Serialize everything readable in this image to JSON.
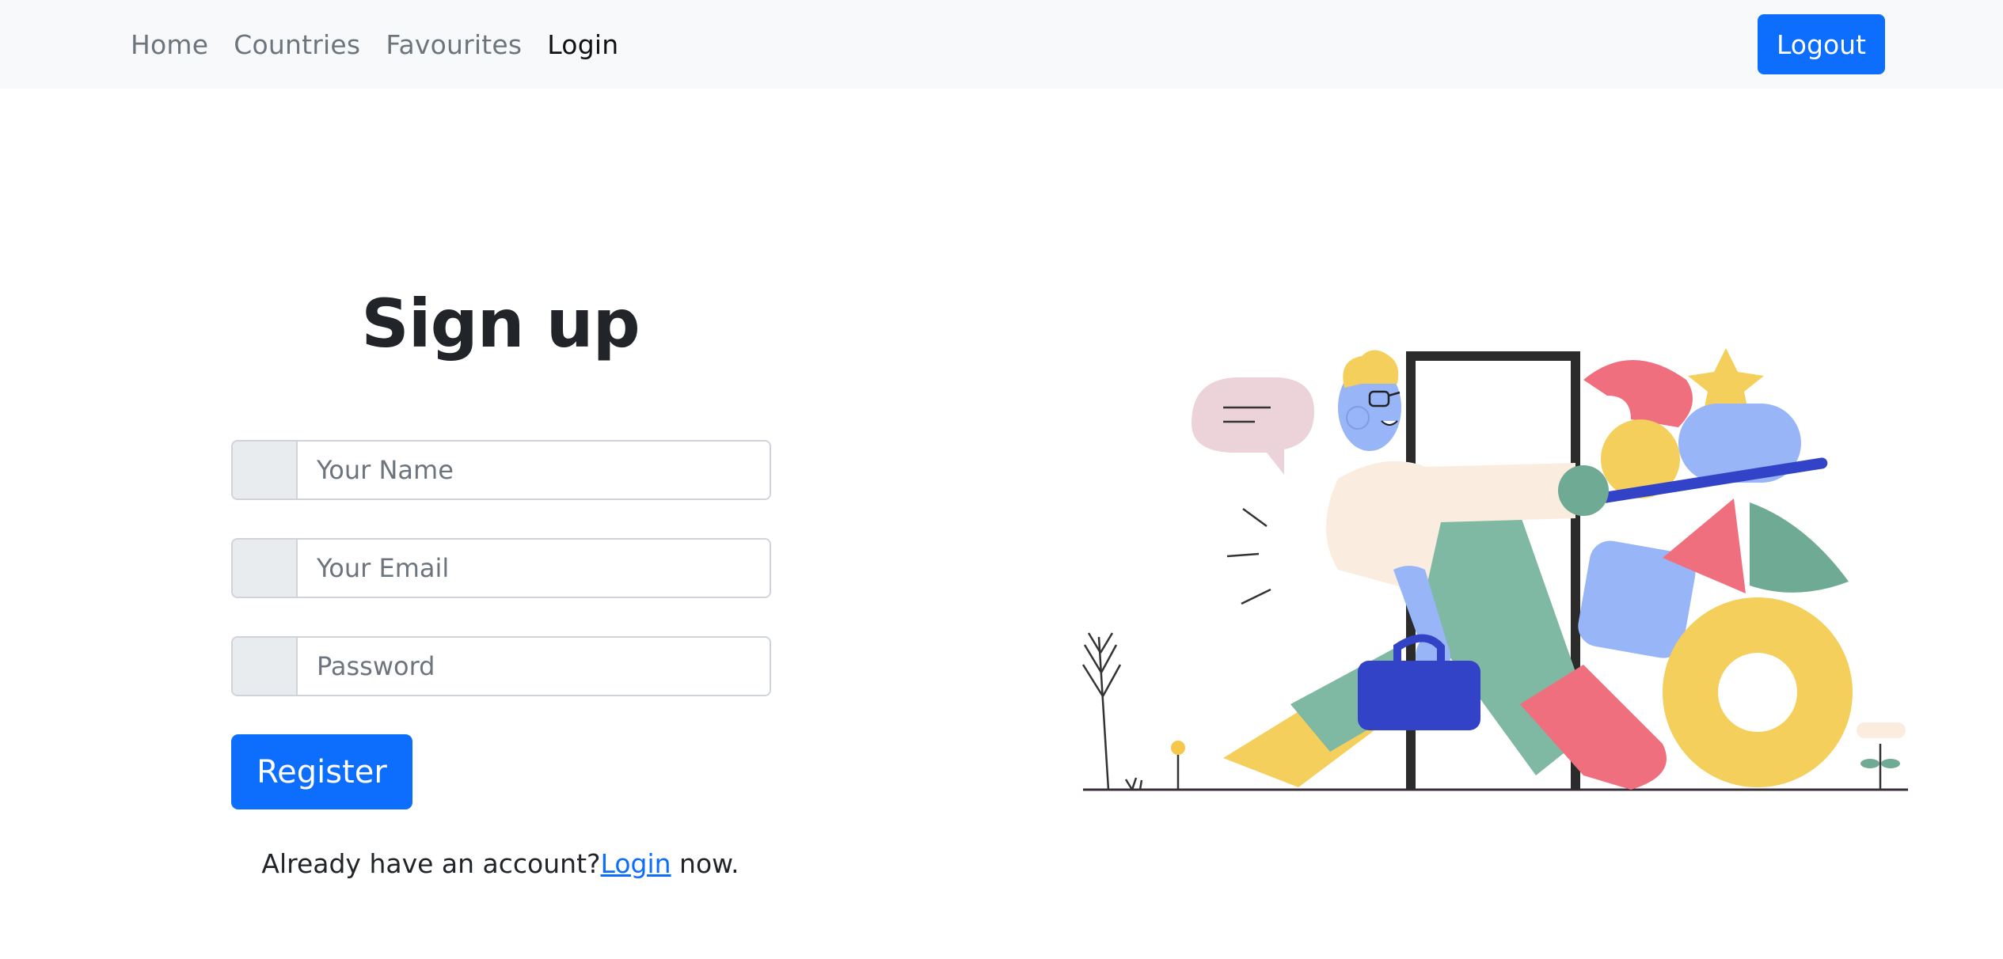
{
  "navbar": {
    "links": [
      {
        "label": "Home"
      },
      {
        "label": "Countries"
      },
      {
        "label": "Favourites"
      },
      {
        "label": "Login"
      }
    ],
    "logout_label": "Logout"
  },
  "form": {
    "title": "Sign up",
    "name_placeholder": "Your Name",
    "email_placeholder": "Your Email",
    "password_placeholder": "Password",
    "register_label": "Register",
    "already_prefix": "Already have an account?",
    "login_link_label": "Login",
    "already_suffix": " now."
  },
  "illustration": {
    "icon": "person-walking-through-door-with-shapes-illustration"
  },
  "colors": {
    "primary": "#0d6efd",
    "navbar_bg": "#f8f9fa",
    "addon_bg": "#e9ecef",
    "muted_text": "#6c757d"
  }
}
